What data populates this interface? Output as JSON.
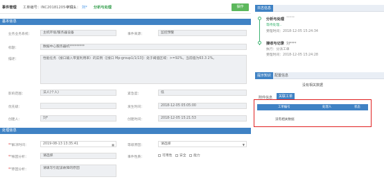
{
  "header": {
    "title": "事件管理",
    "ticket_no": "工单编号：INC20181205-2721",
    "applicant_label": "申请人：",
    "applicant_value": "刘*",
    "stage": "分析与处理",
    "action_button": "操作"
  },
  "basic_info": {
    "section_title": "基本信息",
    "business_system_label": "业务业务系统：",
    "business_system_value": "主机环境/服务器设备",
    "event_source_label": "事件来源：",
    "event_source_value": "监控预警",
    "title_label": "标题：",
    "title_value": "数据中心服务器机*********",
    "description_label": "描述：",
    "description_value": "性能任务（接口输入带宽利用率）的实例（[接口 Mp-group1/1/13]）处于阈值区域：>=92%。当前值为63.3 2%。",
    "impact_label": "影响范围：",
    "impact_value": "法人(个人)",
    "urgency_label": "紧急度：",
    "urgency_value": "低",
    "priority_label": "优先级：",
    "priority_value": "",
    "occur_time_label": "发生时间：",
    "occur_time_value": "2018-12-05 05:05:00",
    "creator_label": "创建人：",
    "creator_value": "刘*",
    "create_time_label": "创建时间：",
    "create_time_value": "2018-12-05 15:21:53"
  },
  "processing": {
    "section_title": "处理信息",
    "resolve_time_label": "*解决时间：",
    "resolve_time_value": "2019-08-13 13:35:41",
    "level_reason_label": "等级原因：",
    "level_reason_value": "请选择",
    "root_cause_label": "*根因分析：",
    "root_cause_placeholder": "请选择",
    "event_nature_label": "事件性质：",
    "nature_options": [
      "可用性",
      "安全",
      "能力"
    ],
    "cause_analysis_label": "*原因分析：",
    "cause_analysis_placeholder": "请填写引起该故障的原因"
  },
  "log": {
    "tab": "日志信息",
    "entries": [
      {
        "title": "分析与处理",
        "name": "*****",
        "status": "等待处理..",
        "time_label": "受理时间：",
        "time_value": "2018-12-05 15:24:34"
      },
      {
        "title": "接收与记录",
        "name": "刘****",
        "executor_label": "执行：",
        "executor_value": "分派工单",
        "time_label": "受理时间：",
        "time_value": "2018-12-05 15:24:28"
      }
    ]
  },
  "knowledge": {
    "tabs": [
      "提示知识",
      "配置信息"
    ],
    "empty_text": "没有相关数据",
    "sub_tabs": [
      "附件信息",
      "关联工单"
    ],
    "table_headers": [
      "工单编号",
      "处理人",
      "状态"
    ],
    "table_empty": "没有相关数据"
  }
}
